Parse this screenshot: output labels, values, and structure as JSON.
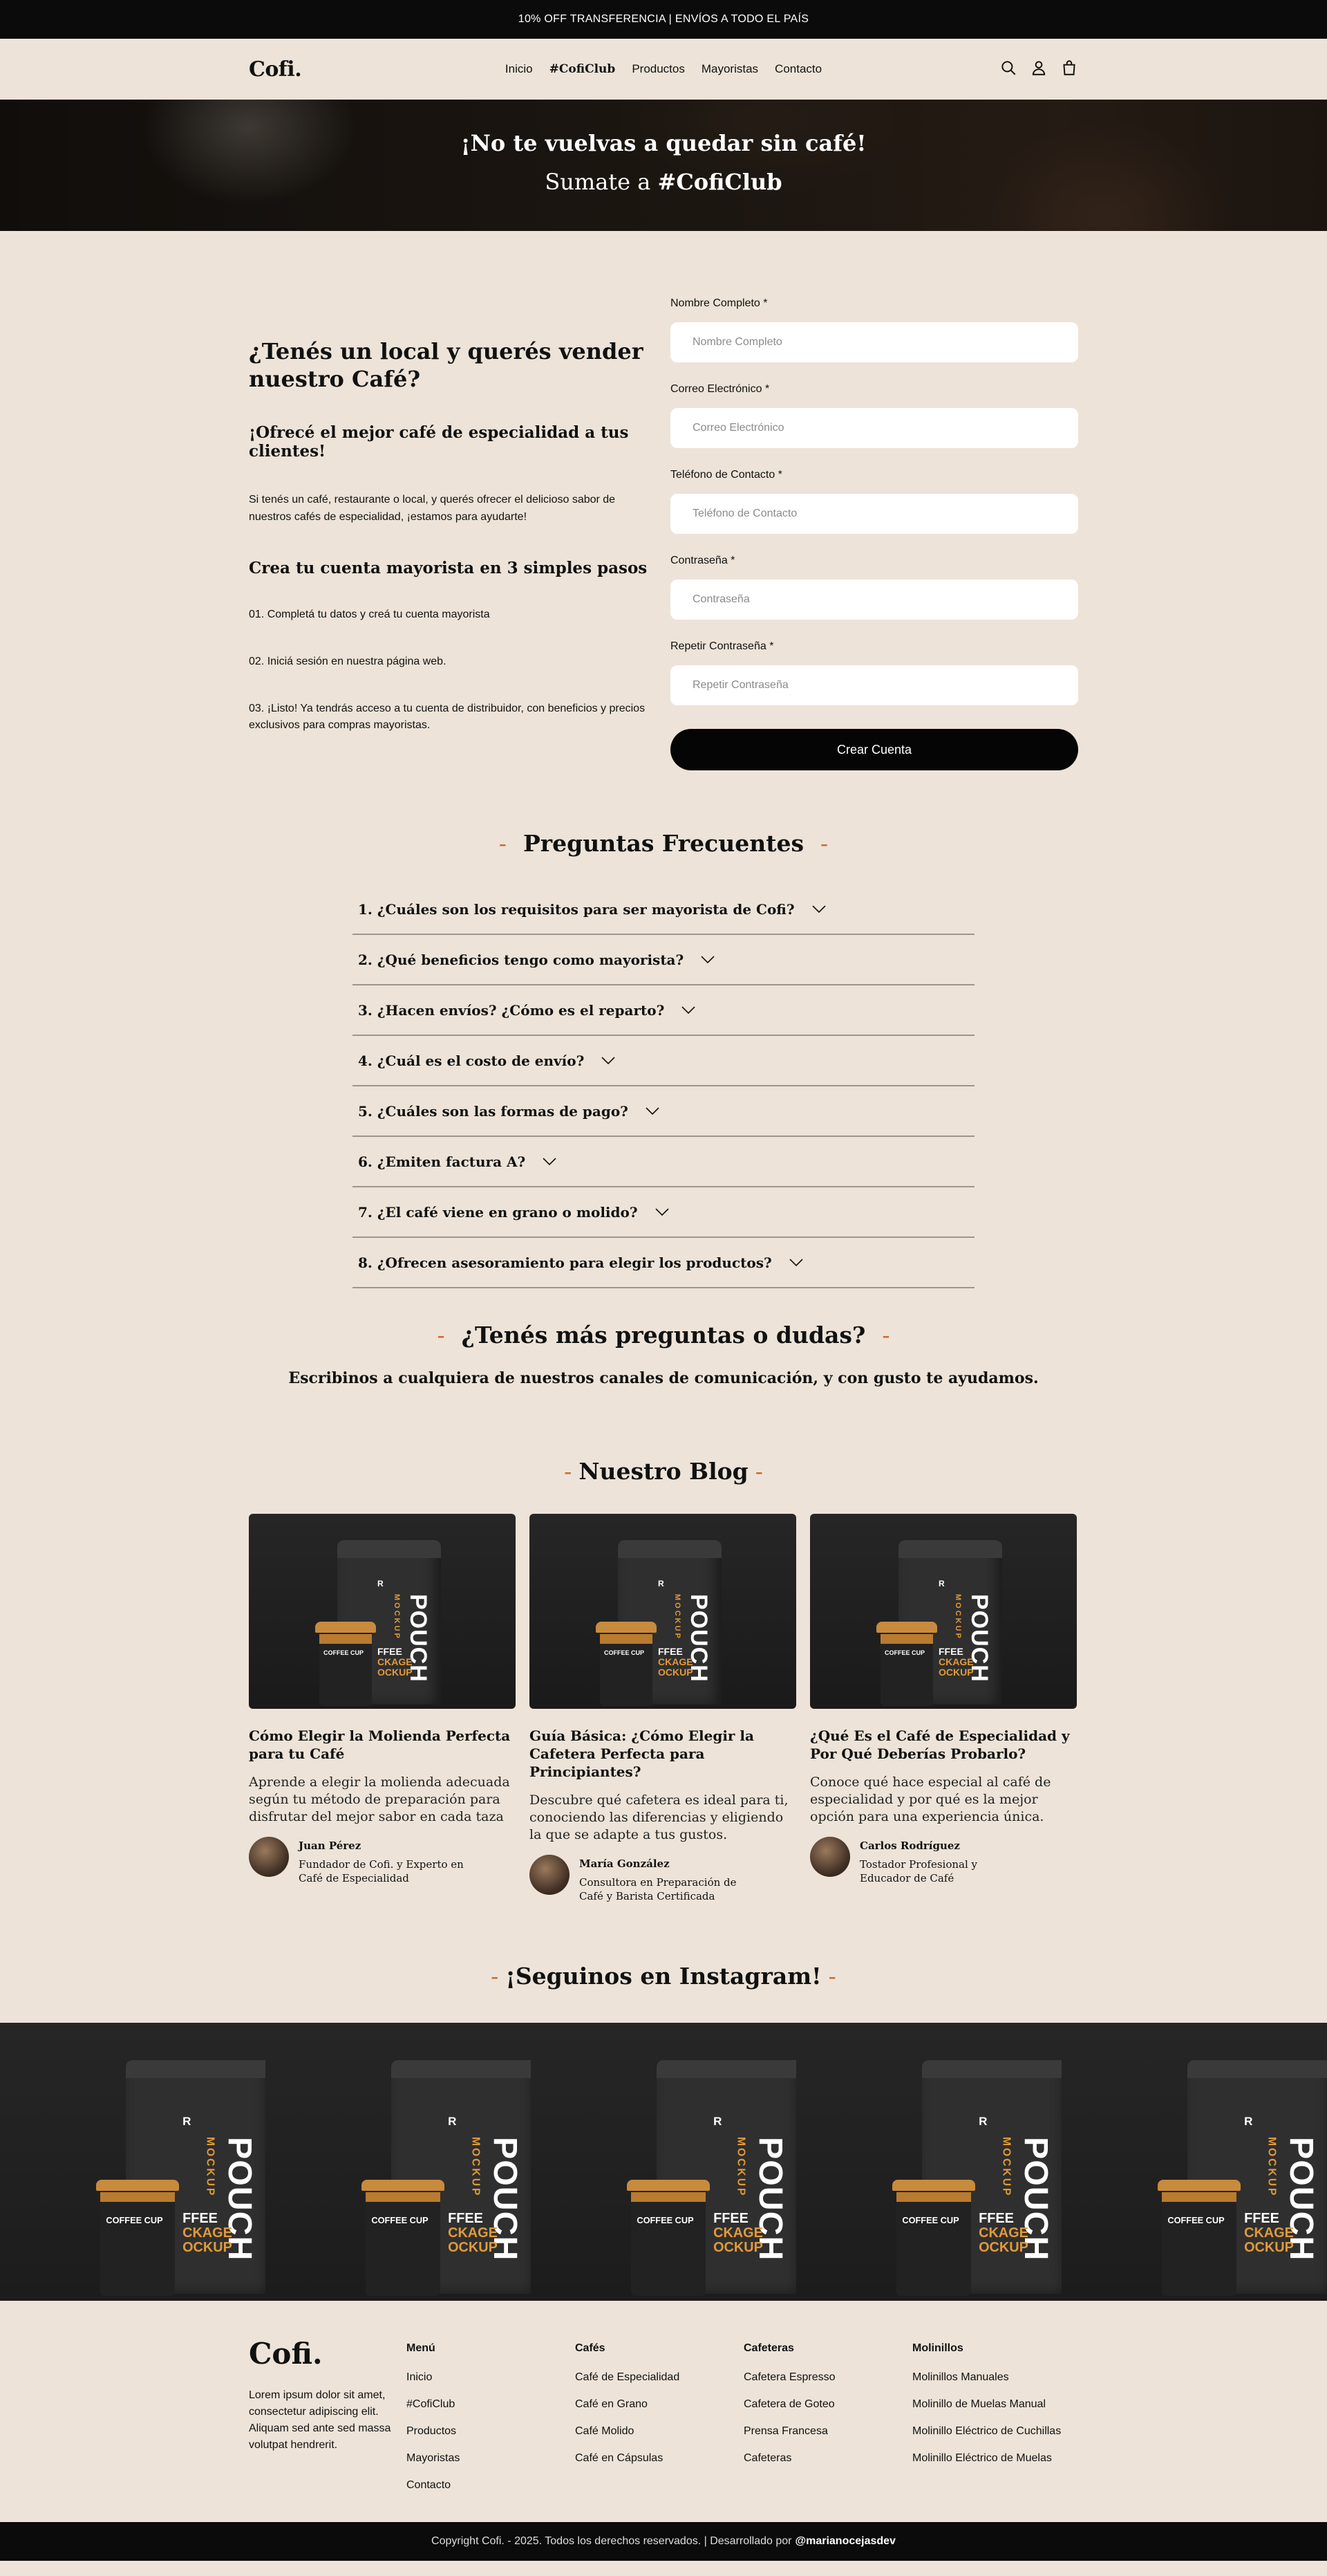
{
  "announcement": "10% OFF TRANSFERENCIA | ENVÍOS A TODO EL PAÍS",
  "nav": {
    "logo": "Cofi.",
    "links": [
      "Inicio",
      "#CofiClub",
      "Productos",
      "Mayoristas",
      "Contacto"
    ],
    "icons": [
      "search-icon",
      "user-icon",
      "bag-icon"
    ]
  },
  "hero": {
    "title": "¡No te vuelvas a quedar sin café!",
    "subtitle_prefix": "Sumate a",
    "subtitle_highlight": "#CofiClub"
  },
  "wholesale": {
    "heading": "¿Tenés un local y querés vender nuestro Café?",
    "subheading": "¡Ofrecé el mejor café de especialidad a tus clientes!",
    "description": "Si tenés un café, restaurante o local, y querés ofrecer el delicioso sabor de nuestros cafés de especialidad, ¡estamos para ayudarte!",
    "steps_title": "Crea tu cuenta mayorista en 3 simples pasos",
    "steps": [
      "01. Completá tu datos y creá tu cuenta mayorista",
      "02. Iniciá sesión en nuestra página web.",
      "03. ¡Listo! Ya tendrás acceso a tu cuenta de distribuidor, con beneficios y precios exclusivos para compras mayoristas."
    ]
  },
  "form": {
    "fields": [
      {
        "label": "Nombre Completo *",
        "placeholder": "Nombre Completo",
        "value": ""
      },
      {
        "label": "Correo Electrónico *",
        "placeholder": "Correo Electrónico",
        "value": ""
      },
      {
        "label": "Teléfono de Contacto *",
        "placeholder": "Teléfono de Contacto",
        "value": ""
      },
      {
        "label": "Contraseña *",
        "placeholder": "Contraseña",
        "value": ""
      },
      {
        "label": "Repetir Contraseña *",
        "placeholder": "Repetir Contraseña",
        "value": ""
      }
    ],
    "submit": "Crear Cuenta"
  },
  "faq": {
    "title": "Preguntas Frecuentes",
    "items": [
      "1. ¿Cuáles son los requisitos para ser mayorista de Cofi?",
      "2. ¿Qué beneficios tengo como mayorista?",
      "3. ¿Hacen envíos? ¿Cómo es el reparto?",
      "4. ¿Cuál es el costo de envío?",
      "5. ¿Cuáles son las formas de pago?",
      "6. ¿Emiten factura A?",
      "7. ¿El café viene en grano o molido?",
      "8. ¿Ofrecen asesoramiento para elegir los productos?"
    ]
  },
  "more": {
    "title": "¿Tenés más preguntas o dudas?",
    "text": "Escribinos a cualquiera de nuestros canales de comunicación, y con gusto te ayudamos."
  },
  "blog": {
    "title": "Nuestro Blog",
    "posts": [
      {
        "title": "Cómo Elegir la Molienda Perfecta para tu Café",
        "excerpt": "Aprende a elegir la molienda adecuada según tu método de preparación para disfrutar del mejor sabor en cada taza",
        "author": "Juan Pérez",
        "role": "Fundador de Cofi. y Experto en Café de Especialidad"
      },
      {
        "title": "Guía Básica: ¿Cómo Elegir la Cafetera Perfecta para Principiantes?",
        "excerpt": "Descubre qué cafetera es ideal para ti, conociendo las diferencias y eligiendo la que se adapte a tus gustos.",
        "author": "María González",
        "role": "Consultora en Preparación de Café y Barista Certificada"
      },
      {
        "title": "¿Qué Es el Café de Especialidad y Por Qué Deberías Probarlo?",
        "excerpt": "Conoce qué hace especial al café de especialidad y por qué es la mejor opción para una experiencia única.",
        "author": "Carlos Rodríguez",
        "role": "Tostador Profesional y Educador de Café"
      }
    ]
  },
  "mockup": {
    "brand_letter": "R",
    "pouch": "POUCH",
    "mockup": "MOCKUP",
    "coffee_cup": "COFFEE CUP",
    "package_top": "FFEE",
    "package_mid": "CKAGE",
    "package_bottom": "OCKUP"
  },
  "instagram": {
    "title": "¡Seguinos en Instagram!",
    "tiles": 5
  },
  "footer": {
    "logo": "Cofi.",
    "description": "Lorem ipsum dolor sit amet, consectetur adipiscing elit. Aliquam sed ante sed massa volutpat hendrerit.",
    "columns": [
      {
        "title": "Menú",
        "links": [
          "Inicio",
          "#CofiClub",
          "Productos",
          "Mayoristas",
          "Contacto"
        ]
      },
      {
        "title": "Cafés",
        "links": [
          "Café de Especialidad",
          "Café en Grano",
          "Café Molido",
          "Café en Cápsulas"
        ]
      },
      {
        "title": "Cafeteras",
        "links": [
          "Cafetera Espresso",
          "Cafetera de Goteo",
          "Prensa Francesa",
          "Cafeteras"
        ]
      },
      {
        "title": "Molinillos",
        "links": [
          "Molinillos Manuales",
          "Molinillo de Muelas Manual",
          "Molinillo Eléctrico de Cuchillas",
          "Molinillo Eléctrico de Muelas"
        ]
      }
    ],
    "copyright": "Copyright Cofi. - 2025. Todos los derechos reservados. | Desarrollado por",
    "developer": "@marianocejasdev"
  },
  "colors": {
    "background": "#ede3d8",
    "accent": "#c96a33",
    "dark": "#0b0b0b"
  }
}
